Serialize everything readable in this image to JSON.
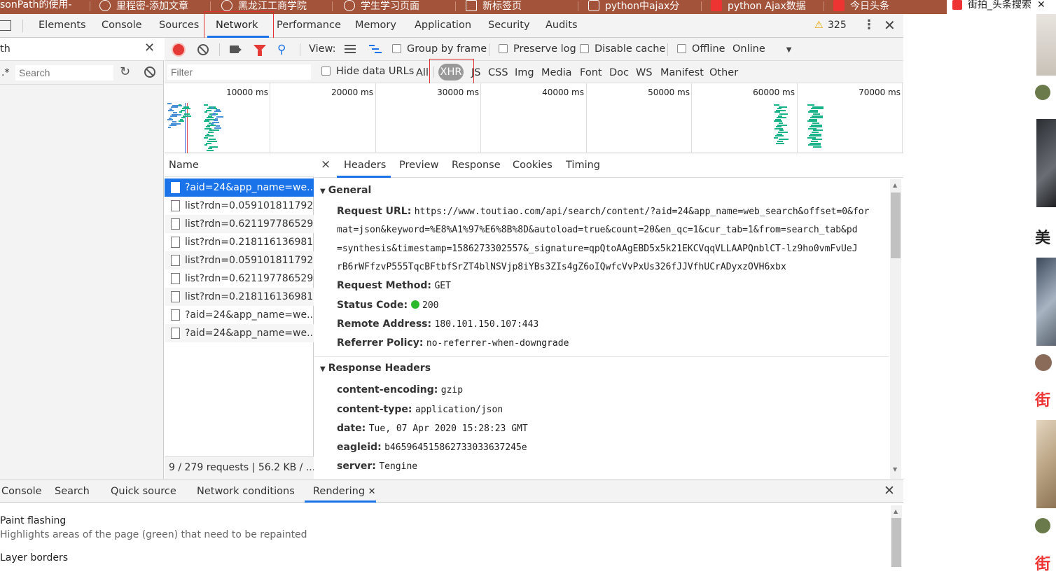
{
  "browser_tabs": [
    {
      "label": "sonPath的使用-"
    },
    {
      "label": "里程密-添加文章"
    },
    {
      "label": "黑龙江工商学院"
    },
    {
      "label": "学生学习页面"
    },
    {
      "label": "新标签页"
    },
    {
      "label": "python中ajax分"
    },
    {
      "label": "python Ajax数据"
    },
    {
      "label": "今日头条"
    },
    {
      "label": "街拍_头条搜索"
    }
  ],
  "devtools": {
    "panels": [
      "Elements",
      "Console",
      "Sources",
      "Network",
      "Performance",
      "Memory",
      "Application",
      "Security",
      "Audits"
    ],
    "active_panel": "Network",
    "warnings_count": "325"
  },
  "search_panel": {
    "query": "th",
    "regex_label": ".*",
    "search_placeholder": "Search"
  },
  "network_toolbar": {
    "view_label": "View:",
    "group_by_frame": "Group by frame",
    "preserve_log": "Preserve log",
    "disable_cache": "Disable cache",
    "offline": "Offline",
    "throttle": "Online"
  },
  "filter_bar": {
    "filter_placeholder": "Filter",
    "hide_data_urls": "Hide data URLs",
    "types": [
      "All",
      "XHR",
      "JS",
      "CSS",
      "Img",
      "Media",
      "Font",
      "Doc",
      "WS",
      "Manifest",
      "Other"
    ],
    "active_type": "XHR"
  },
  "overview": {
    "ticks": [
      "10000 ms",
      "20000 ms",
      "30000 ms",
      "40000 ms",
      "50000 ms",
      "60000 ms",
      "70000 ms"
    ]
  },
  "request_list": {
    "header": "Name",
    "items": [
      "?aid=24&app_name=we...",
      "list?rdn=0.059101811792...",
      "list?rdn=0.621197786529...",
      "list?rdn=0.218116136981...",
      "list?rdn=0.059101811792...",
      "list?rdn=0.621197786529...",
      "list?rdn=0.218116136981...",
      "?aid=24&app_name=we...",
      "?aid=24&app_name=we..."
    ],
    "status": "9 / 279 requests  |  56.2 KB / ..."
  },
  "detail": {
    "close": "×",
    "tabs": [
      "Headers",
      "Preview",
      "Response",
      "Cookies",
      "Timing"
    ],
    "active_tab": "Headers",
    "general": {
      "title": "General",
      "request_url_label": "Request URL:",
      "request_url_lines": [
        "https://www.toutiao.com/api/search/content/?aid=24&app_name=web_search&offset=0&for",
        "mat=json&keyword=%E8%A1%97%E6%8B%8D&autoload=true&count=20&en_qc=1&cur_tab=1&from=search_tab&pd",
        "=synthesis&timestamp=1586273302557&_signature=qpQtoAAgEBD5x5k21EKCVqqVLLAAPQnblCT-lz9ho0vmFvUeJ",
        "rB6rWFfzvP555TqcBFtbfSrZT4blNSVjp8iYBs3ZIs4gZ6oIQwfcVvPxUs326fJJVfhUCrADyxzOVH6xbx"
      ],
      "request_method_label": "Request Method:",
      "request_method": "GET",
      "status_code_label": "Status Code:",
      "status_code": "200",
      "remote_address_label": "Remote Address:",
      "remote_address": "180.101.150.107:443",
      "referrer_policy_label": "Referrer Policy:",
      "referrer_policy": "no-referrer-when-downgrade"
    },
    "response_headers": {
      "title": "Response Headers",
      "rows": [
        {
          "key": "content-encoding:",
          "value": "gzip"
        },
        {
          "key": "content-type:",
          "value": "application/json"
        },
        {
          "key": "date:",
          "value": "Tue, 07 Apr 2020 15:28:23 GMT"
        },
        {
          "key": "eagleid:",
          "value": "b465964515862733033637245e"
        },
        {
          "key": "server:",
          "value": "Tengine"
        }
      ]
    }
  },
  "drawer": {
    "tabs": [
      "Console",
      "Search",
      "Quick source",
      "Network conditions",
      "Rendering"
    ],
    "active_tab": "Rendering",
    "items": [
      {
        "title": "Paint flashing",
        "desc": "Highlights areas of the page (green) that need to be repainted"
      },
      {
        "title": "Layer borders",
        "desc": ""
      }
    ]
  },
  "right_page": {
    "snippets": [
      "美",
      "街",
      "街"
    ]
  },
  "colors": {
    "accent": "#1a73e8",
    "record": "#e53935",
    "status_ok": "#2eb82e",
    "waterfall_green": "#1bb38a",
    "waterfall_blue": "#4a90d9",
    "highlight_box": "#e03030"
  }
}
